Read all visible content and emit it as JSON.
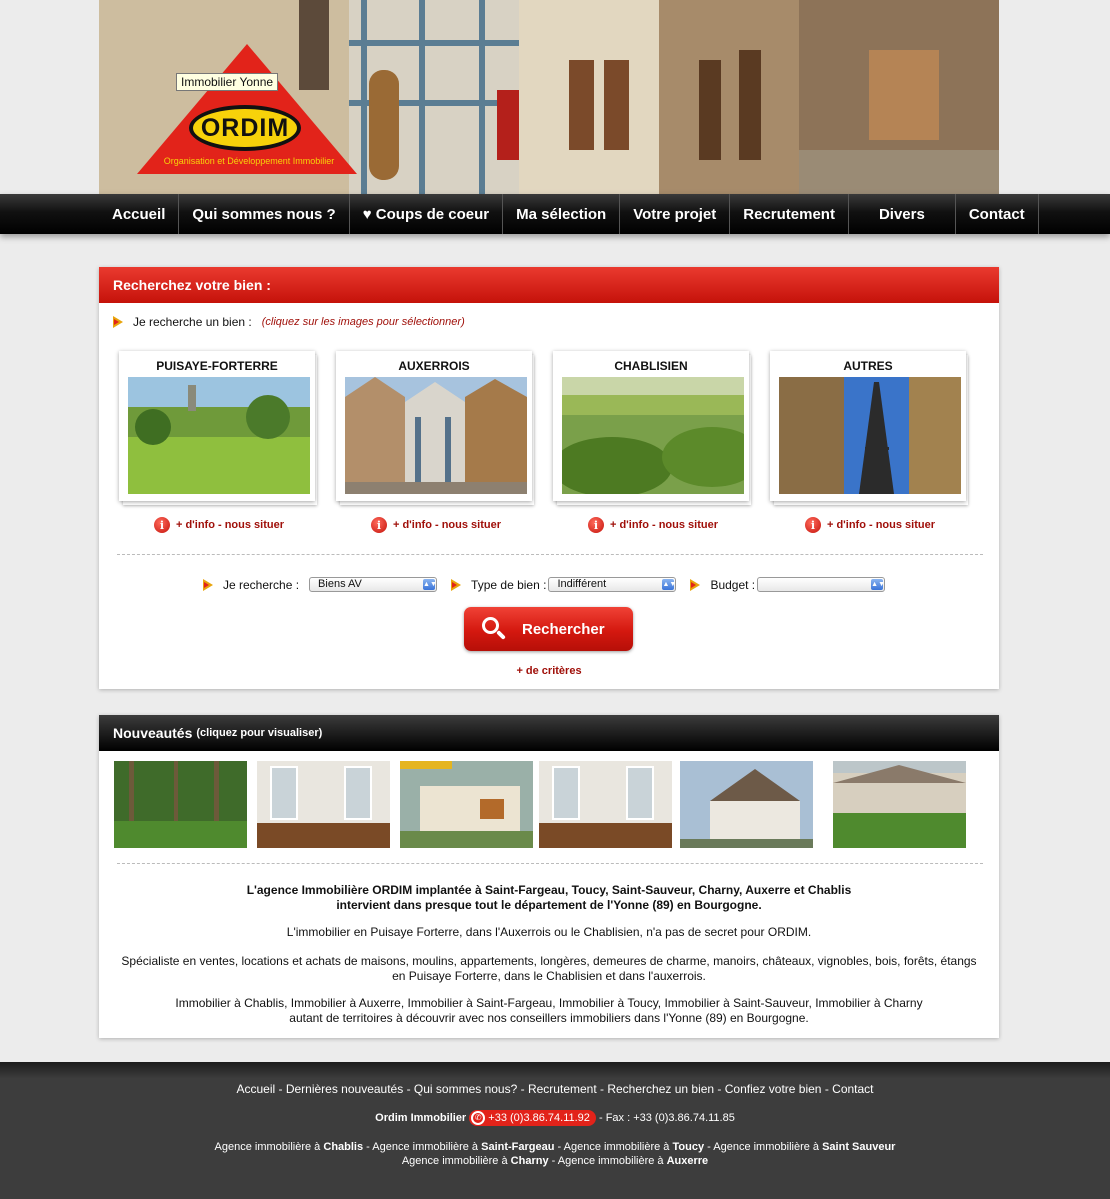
{
  "header": {
    "logo_text": "ORDIM",
    "logo_subtitle": "Organisation et Développement Immobilier",
    "logo_tooltip": "Immobilier Yonne"
  },
  "nav": {
    "items": [
      "Accueil",
      "Qui sommes nous ?",
      "♥ Coups de coeur",
      "Ma sélection",
      "Votre projet",
      "Recrutement",
      "Divers",
      "Contact"
    ]
  },
  "search": {
    "title": "Recherchez votre bien :",
    "intro_label": "Je recherche un bien :",
    "intro_hint": "(cliquez sur les images pour sélectionner)",
    "regions": [
      {
        "title": "PUISAYE-FORTERRE",
        "info": "+ d'info - nous situer"
      },
      {
        "title": "AUXERROIS",
        "info": "+ d'info - nous situer"
      },
      {
        "title": "CHABLISIEN",
        "info": "+ d'info - nous situer"
      },
      {
        "title": "AUTRES",
        "info": "+ d'info - nous situer"
      }
    ],
    "filters": {
      "recherche_label": "Je recherche :",
      "recherche_value": "Biens AV",
      "type_label": "Type de bien :",
      "type_value": "Indifférent",
      "budget_label": "Budget :",
      "budget_value": ""
    },
    "button_label": "Rechercher",
    "more_criteria": "+ de critères"
  },
  "news": {
    "title": "Nouveautés",
    "hint": "(cliquez pour visualiser)"
  },
  "about": {
    "line1": "L'agence Immobilière ORDIM implantée à Saint-Fargeau, Toucy, Saint-Sauveur, Charny, Auxerre et Chablis",
    "line2": "intervient dans presque tout le département de l'Yonne (89) en Bourgogne.",
    "line3": "L'immobilier en Puisaye Forterre, dans l'Auxerrois ou le Chablisien, n'a pas de secret pour ORDIM.",
    "line4": "Spécialiste en ventes, locations et achats de maisons, moulins, appartements, longères, demeures de charme, manoirs, châteaux, vignobles, bois, forêts, étangs",
    "line5": "en Puisaye Forterre, dans le Chablisien et dans l'auxerrois.",
    "line6": "Immobilier à Chablis, Immobilier à Auxerre, Immobilier à Saint-Fargeau, Immobilier à Toucy, Immobilier à Saint-Sauveur, Immobilier à Charny",
    "line7": "autant de territoires à découvrir avec nos conseillers immobiliers dans l'Yonne (89) en Bourgogne."
  },
  "footer": {
    "links": [
      "Accueil",
      "Dernières nouveautés",
      "Qui sommes nous?",
      "Recrutement",
      "Recherchez un bien",
      "Confiez votre bien",
      "Contact"
    ],
    "company": "Ordim Immobilier",
    "phone": "+33 (0)3.86.74.11.92",
    "fax": "- Fax : +33 (0)3.86.74.11.85",
    "agency_prefix": "Agence immobilière à",
    "agencies_row1": [
      "Chablis",
      "Saint-Fargeau",
      "Toucy",
      "Saint Sauveur"
    ],
    "agencies_row2": [
      "Charny",
      "Auxerre"
    ]
  },
  "colors": {
    "brand_red": "#e2231a",
    "brand_yellow": "#f7d20a",
    "link_red": "#a0100a"
  }
}
